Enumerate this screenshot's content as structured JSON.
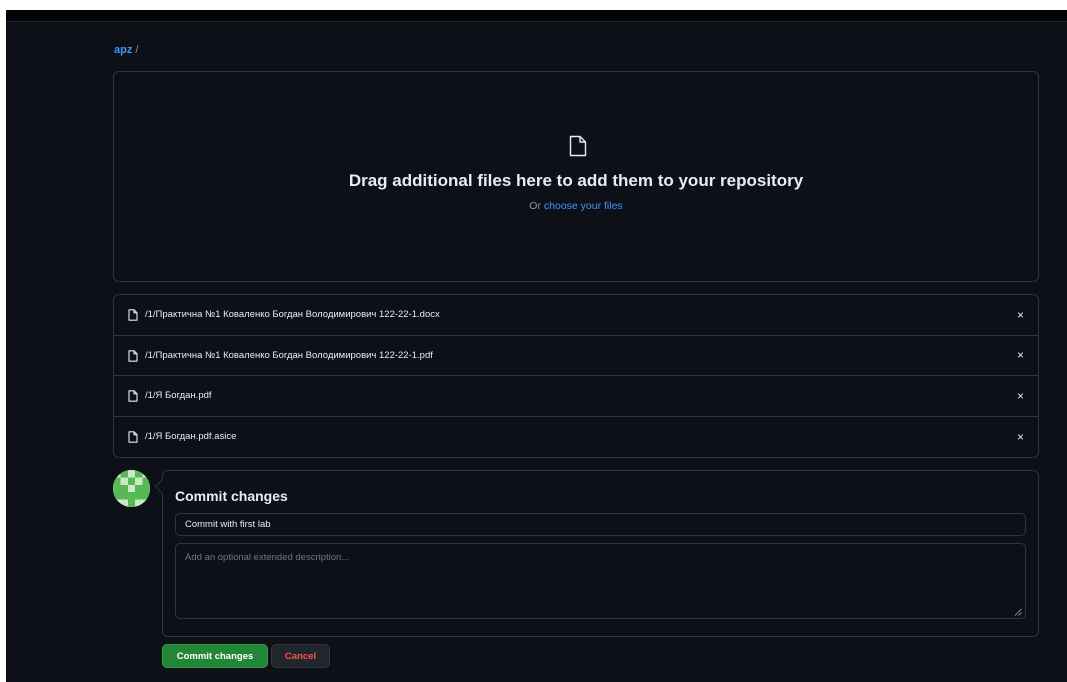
{
  "breadcrumb": {
    "repo": "apz",
    "separator": "/"
  },
  "dropzone": {
    "icon": "file-icon",
    "title": "Drag additional files here to add them to your repository",
    "prefix": "Or",
    "link": "choose your files"
  },
  "files": [
    {
      "name": "/1/Практична №1 Коваленко Богдан Володимирович 122-22-1.docx",
      "remove": "×"
    },
    {
      "name": "/1/Практична №1 Коваленко Богдан Володимирович 122-22-1.pdf",
      "remove": "×"
    },
    {
      "name": "/1/Я Богдан.pdf",
      "remove": "×"
    },
    {
      "name": "/1/Я Богдан.pdf.asice",
      "remove": "×"
    }
  ],
  "commit": {
    "title": "Commit changes",
    "message": "Commit with first lab",
    "description_placeholder": "Add an optional extended description...",
    "submit_label": "Commit changes",
    "cancel_label": "Cancel"
  },
  "colors": {
    "background": "#0d1117",
    "border": "#30363d",
    "link": "#4493f8",
    "primary_button": "#238636",
    "danger_text": "#f85149"
  }
}
